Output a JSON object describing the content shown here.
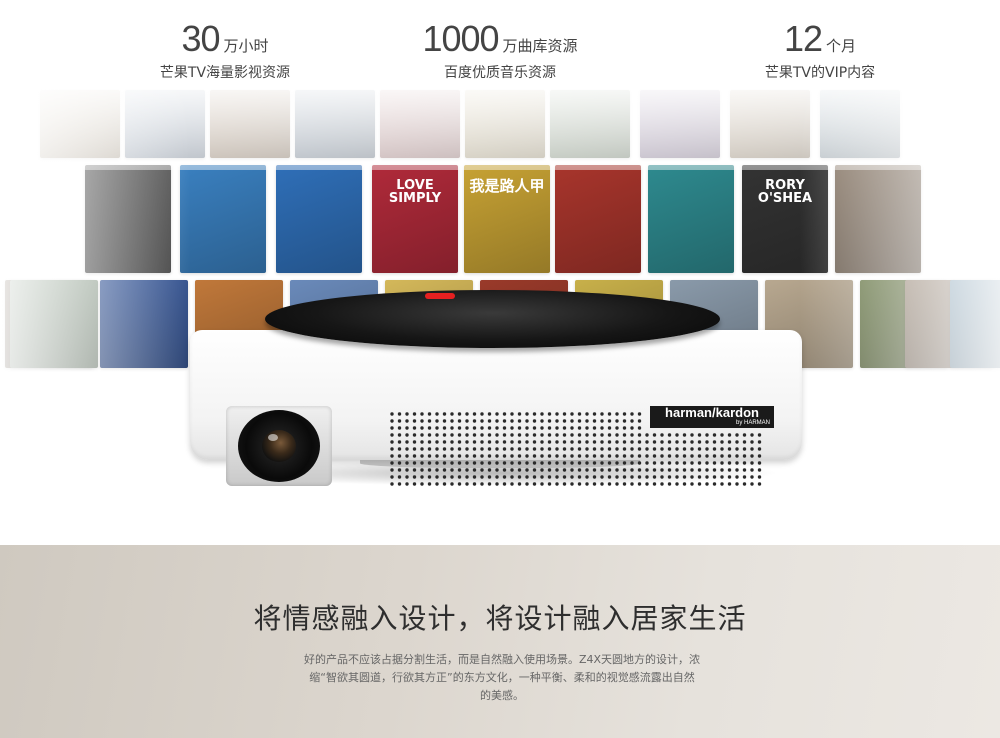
{
  "stats": [
    {
      "number": "30",
      "unit": "万小时",
      "subtitle": "芒果TV海量影视资源"
    },
    {
      "number": "1000",
      "unit": "万曲库资源",
      "subtitle": "百度优质音乐资源"
    },
    {
      "number": "12",
      "unit": "个月",
      "subtitle": "芒果TV的VIP内容"
    }
  ],
  "posters": [
    {
      "color": "#c9b9a0"
    },
    {
      "color": "#a8b6c8"
    },
    {
      "color": "#b9a48e"
    },
    {
      "color": "#9aa8b8"
    },
    {
      "color": "#c8a2a2"
    },
    {
      "color": "#d3c7a8"
    },
    {
      "color": "#a9b8a4"
    },
    {
      "color": "#b4a6c0"
    },
    {
      "color": "#c2b29c"
    },
    {
      "color": "#9fb0bb"
    },
    {
      "color": "#5a5a5a"
    },
    {
      "color": "#3a80c0"
    },
    {
      "color": "#2f6fb8"
    },
    {
      "color": "#b02a3a",
      "label": "LOVE SIMPLY"
    },
    {
      "color": "#c7a234",
      "label": "我是路人甲"
    },
    {
      "color": "#a8352c"
    },
    {
      "color": "#2e8a8f"
    },
    {
      "color": "#333333",
      "label": "RORY O'SHEA"
    },
    {
      "color": "#8a7a6a"
    },
    {
      "color": "#7a6a5a"
    },
    {
      "color": "#3a5a9a"
    },
    {
      "color": "#c0783a"
    },
    {
      "color": "#6a8aba"
    },
    {
      "color": "#d4b85a"
    },
    {
      "color": "#9a3a2a"
    },
    {
      "color": "#c8b04a"
    },
    {
      "color": "#8a9aaa"
    },
    {
      "color": "#b8a890"
    },
    {
      "color": "#6a7a4a"
    },
    {
      "color": "#9a8a7a"
    },
    {
      "color": "#7a9ab0"
    },
    {
      "color": "#a0b0a0"
    }
  ],
  "projector": {
    "brand": "harman/kardon",
    "brand_sub": "by HARMAN"
  },
  "feature": {
    "headline": "将情感融入设计，将设计融入居家生活",
    "body_line1": "好的产品不应该占据分割生活，而是自然融入使用场景。Z4X天圆地方的设计，浓",
    "body_line2": "缩“智欲其圆道，行欲其方正”的东方文化，一种平衡、柔和的视觉感流露出自然",
    "body_line3": "的美感。"
  }
}
